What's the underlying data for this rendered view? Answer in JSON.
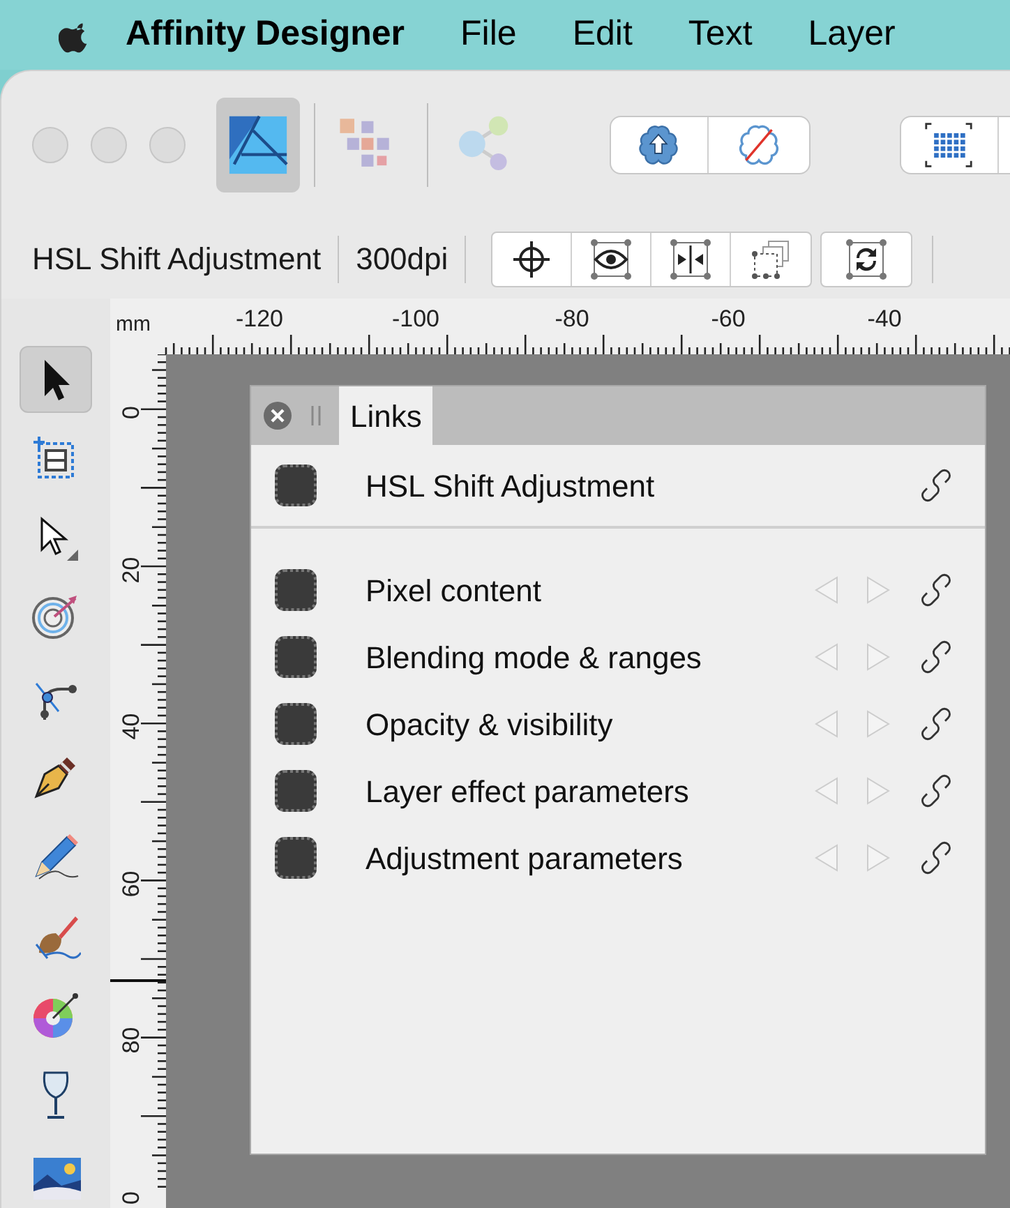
{
  "menu_bar": {
    "app_name": "Affinity Designer",
    "items": [
      "File",
      "Edit",
      "Text",
      "Layer"
    ]
  },
  "toolbar": {
    "personas": [
      {
        "kind": "designer",
        "selected": true
      },
      {
        "kind": "pixel",
        "selected": false
      },
      {
        "kind": "export",
        "selected": false
      }
    ]
  },
  "context_bar": {
    "title": "HSL Shift Adjustment",
    "resolution": "300dpi"
  },
  "ruler": {
    "unit": "mm",
    "horizontal_labels": [
      "-120",
      "-100",
      "-80",
      "-60",
      "-40"
    ],
    "vertical_labels": [
      "0",
      "20",
      "40",
      "60",
      "80",
      "0"
    ]
  },
  "tools": [
    {
      "kind": "move",
      "selected": true
    },
    {
      "kind": "artboard",
      "selected": false
    },
    {
      "kind": "node",
      "selected": false
    },
    {
      "kind": "contour",
      "selected": false
    },
    {
      "kind": "corner",
      "selected": false
    },
    {
      "kind": "pen",
      "selected": false
    },
    {
      "kind": "pencil",
      "selected": false
    },
    {
      "kind": "brush",
      "selected": false
    },
    {
      "kind": "fill",
      "selected": false
    },
    {
      "kind": "transparency",
      "selected": false
    },
    {
      "kind": "image",
      "selected": false
    }
  ],
  "links_panel": {
    "tabs": [
      {
        "label": "Links",
        "selected": true
      }
    ],
    "source": {
      "label": "HSL Shift Adjustment"
    },
    "items": [
      {
        "label": "Pixel content"
      },
      {
        "label": "Blending mode & ranges"
      },
      {
        "label": "Opacity & visibility"
      },
      {
        "label": "Layer effect parameters"
      },
      {
        "label": "Adjustment parameters"
      }
    ]
  }
}
